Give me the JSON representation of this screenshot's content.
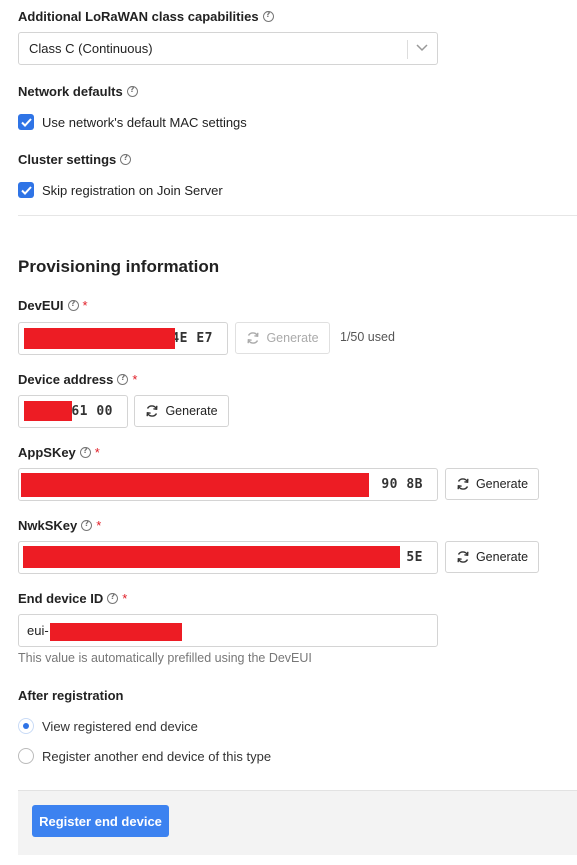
{
  "class_capabilities": {
    "label": "Additional LoRaWAN class capabilities",
    "value": "Class C (Continuous)"
  },
  "network_defaults": {
    "label": "Network defaults",
    "checkbox_label": "Use network's default MAC settings",
    "checked": true
  },
  "cluster_settings": {
    "label": "Cluster settings",
    "checkbox_label": "Skip registration on Join Server",
    "checked": true
  },
  "provisioning": {
    "title": "Provisioning information",
    "dev_eui": {
      "label": "DevEUI",
      "required_mark": "*",
      "visible_value": "4E E7",
      "generate_label": "Generate",
      "usage": "1/50 used"
    },
    "device_address": {
      "label": "Device address",
      "required_mark": "*",
      "visible_value": "61 00",
      "generate_label": "Generate"
    },
    "app_s_key": {
      "label": "AppSKey",
      "required_mark": "*",
      "visible_value": "90 8B",
      "generate_label": "Generate"
    },
    "nwk_s_key": {
      "label": "NwkSKey",
      "required_mark": "*",
      "visible_value": "5E",
      "generate_label": "Generate"
    },
    "end_device_id": {
      "label": "End device ID",
      "required_mark": "*",
      "prefix": "eui-",
      "hint": "This value is automatically prefilled using the DevEUI"
    }
  },
  "after_registration": {
    "label": "After registration",
    "options": [
      {
        "label": "View registered end device",
        "selected": true
      },
      {
        "label": "Register another end device of this type",
        "selected": false
      }
    ]
  },
  "submit": {
    "label": "Register end device"
  },
  "colors": {
    "accent": "#3c82f0",
    "required": "#e01b24",
    "redaction": "#ed1c24"
  }
}
